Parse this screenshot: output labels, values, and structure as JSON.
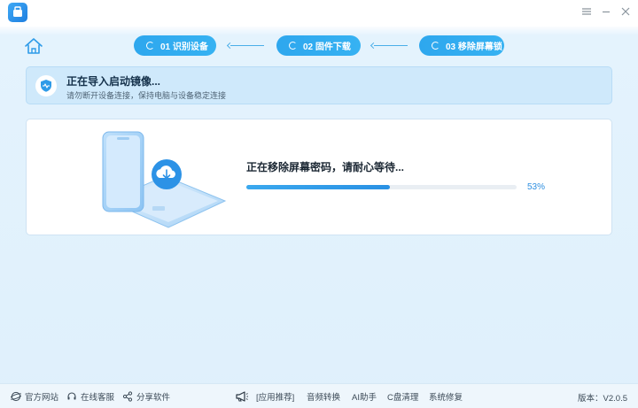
{
  "window": {
    "icons": {
      "logo": "app-logo-icon",
      "menu": "menu-icon",
      "minimize": "minimize-icon",
      "close": "close-icon"
    }
  },
  "steps": [
    {
      "label": "01 识别设备"
    },
    {
      "label": "02 固件下载"
    },
    {
      "label": "03 移除屏幕锁"
    }
  ],
  "status": {
    "title": "正在导入启动镜像...",
    "subtitle": "请勿断开设备连接，保持电脑与设备稳定连接"
  },
  "progress": {
    "label": "正在移除屏幕密码，请耐心等待...",
    "value": 0.53,
    "percent_text": "53%"
  },
  "footer": {
    "links": [
      {
        "label": "官方网站",
        "icon": "globe-icon"
      },
      {
        "label": "在线客服",
        "icon": "headset-icon"
      },
      {
        "label": "分享软件",
        "icon": "share-icon"
      }
    ],
    "promo_icon": "megaphone-icon",
    "promo_items": [
      "[应用推荐]",
      "音频转换",
      "AI助手",
      "C盘清理",
      "系统修复"
    ],
    "version": "版本：V2.0.5"
  },
  "colors": {
    "accent": "#2ea7ee",
    "background": "#dff0fc",
    "progress_track": "#e9eef3"
  }
}
